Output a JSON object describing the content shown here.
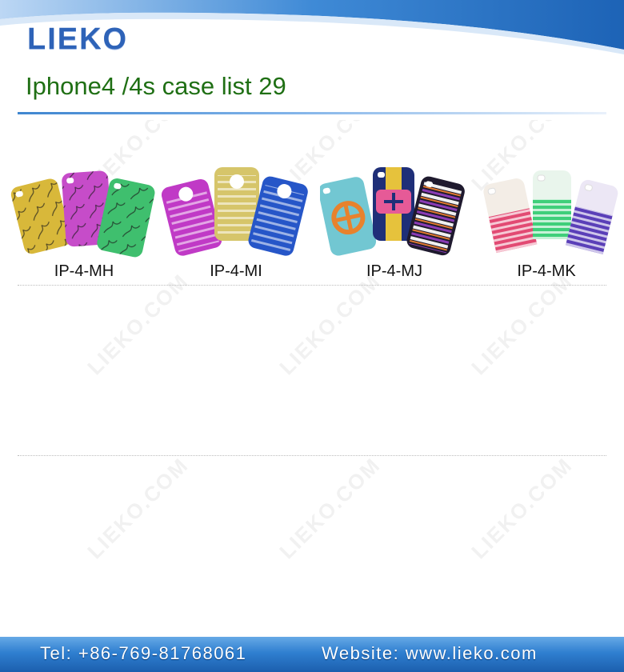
{
  "brand": {
    "logo_text": "LIEKO"
  },
  "page": {
    "title": "Iphone4 /4s case list 29"
  },
  "watermark": {
    "text": "LIEKO.COM"
  },
  "products": [
    {
      "code": "IP-4-MH"
    },
    {
      "code": "IP-4-MI"
    },
    {
      "code": "IP-4-MJ"
    },
    {
      "code": "IP-4-MK"
    }
  ],
  "footer": {
    "tel": "Tel: +86-769-81768061",
    "website": "Website: www.lieko.com"
  },
  "colors": {
    "brand_blue": "#2e63b8",
    "title_green": "#1f6f14",
    "footer_blue": "#2f7fd0"
  }
}
